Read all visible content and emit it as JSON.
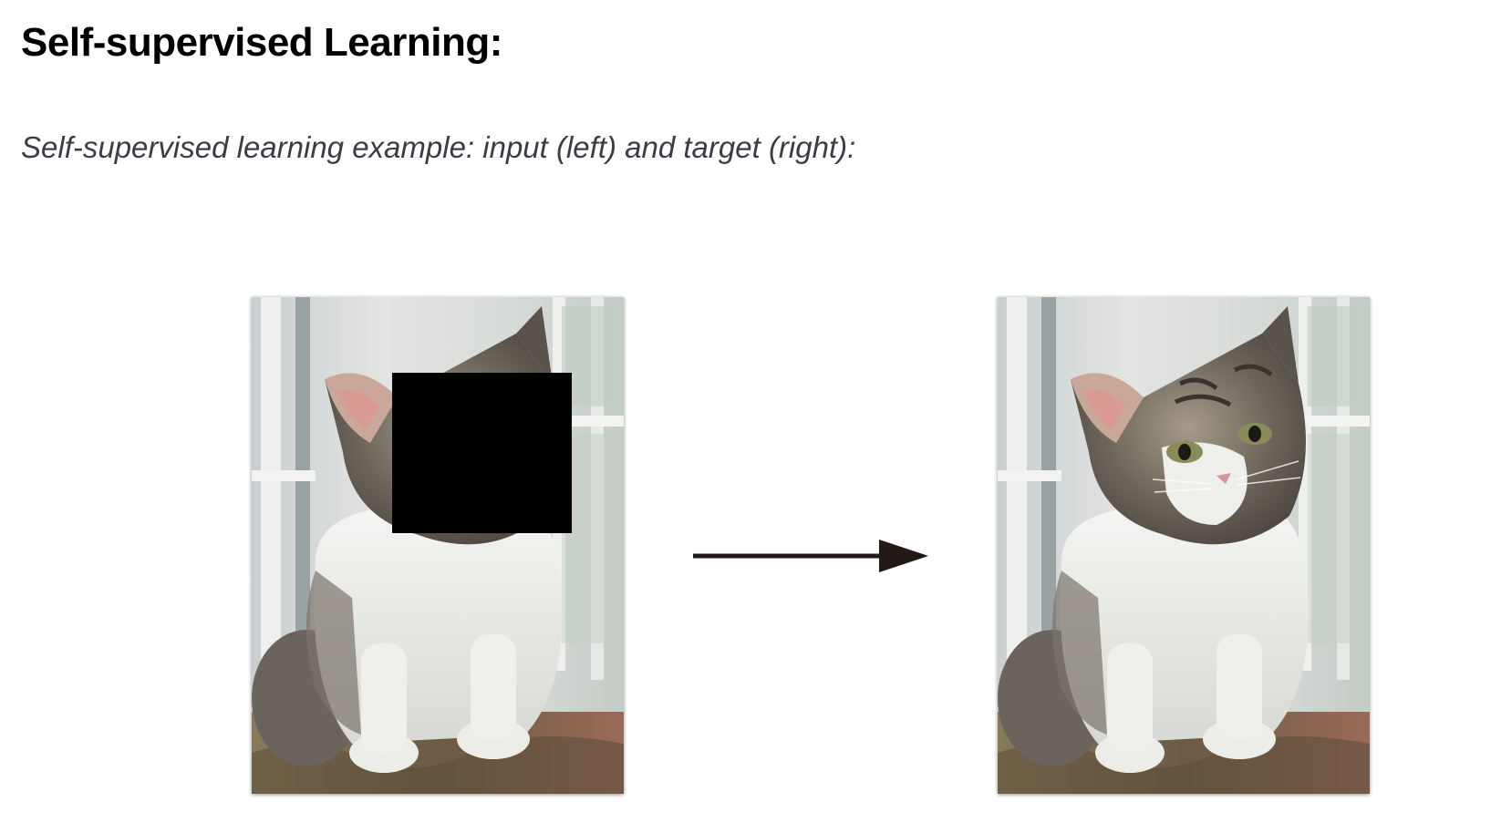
{
  "page": {
    "title": "Self-supervised Learning:",
    "subtitle": "Self-supervised learning example: input (left) and target (right):"
  },
  "figure": {
    "input_image": {
      "subject": "kitten",
      "state": "masked"
    },
    "target_image": {
      "subject": "kitten",
      "state": "complete"
    },
    "arrow_direction": "right"
  },
  "colors": {
    "title": "#000000",
    "subtitle": "#3c3c46",
    "mask": "#000000",
    "arrow": "#231816"
  }
}
